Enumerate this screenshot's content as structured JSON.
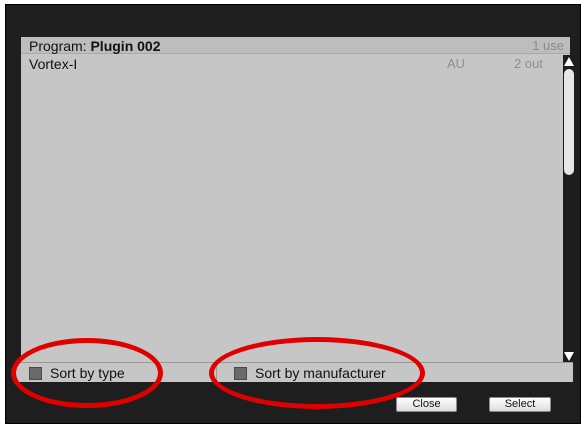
{
  "header": {
    "program_label": "Program:",
    "program_name": "Plugin 002",
    "uses": "1 use"
  },
  "plugins": [
    {
      "name": "Vortex-I",
      "type": "AU",
      "outputs": "2 out"
    }
  ],
  "sort_options": {
    "by_type": {
      "label": "Sort by type",
      "checked": false
    },
    "by_manufacturer": {
      "label": "Sort by manufacturer",
      "checked": false
    }
  },
  "buttons": {
    "close": "Close",
    "select": "Select"
  },
  "colors": {
    "window_bg": "#1e1e1e",
    "panel_bg": "#c6c6c6",
    "annotation_red": "#e10000"
  }
}
